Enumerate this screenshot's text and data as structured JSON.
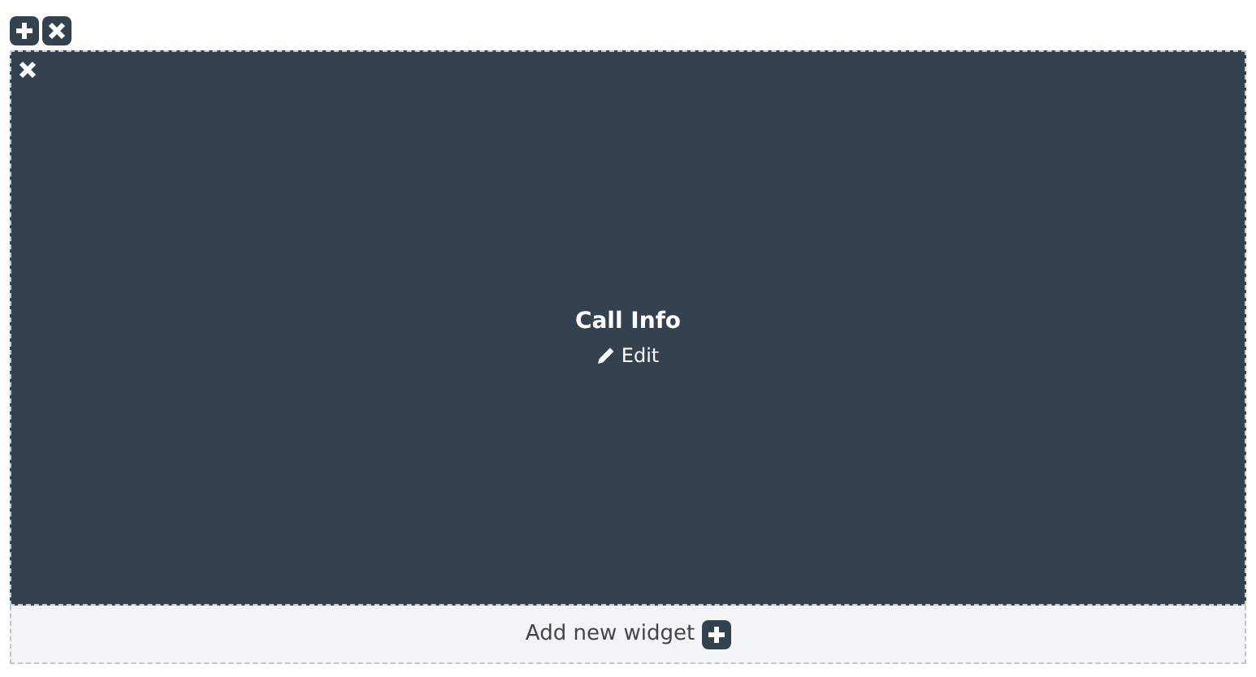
{
  "widget": {
    "title": "Call Info",
    "edit_label": "Edit"
  },
  "footer": {
    "add_label": "Add new widget"
  }
}
